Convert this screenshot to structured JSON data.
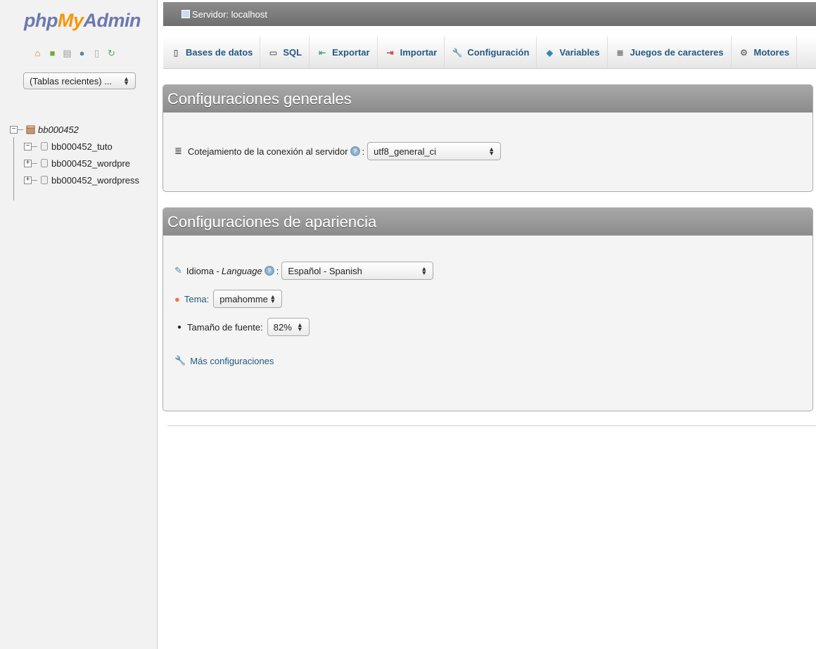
{
  "logo": {
    "php": "php",
    "my": "My",
    "admin": "Admin"
  },
  "sidebar": {
    "recent_tables": "(Tablas recientes) ...",
    "database": "bb000452",
    "tables": [
      "bb000452_tuto",
      "bb000452_wordpre",
      "bb000452_wordpress"
    ],
    "expanders": [
      "−",
      "+",
      "+"
    ]
  },
  "server_bar": {
    "label": "Servidor: localhost"
  },
  "tabs": [
    {
      "label": "Bases de datos",
      "icon": "database-icon"
    },
    {
      "label": "SQL",
      "icon": "sql-icon"
    },
    {
      "label": "Exportar",
      "icon": "export-icon"
    },
    {
      "label": "Importar",
      "icon": "import-icon"
    },
    {
      "label": "Configuración",
      "icon": "wrench-icon"
    },
    {
      "label": "Variables",
      "icon": "variables-icon"
    },
    {
      "label": "Juegos de caracteres",
      "icon": "charset-icon"
    },
    {
      "label": "Motores",
      "icon": "engines-icon"
    }
  ],
  "general": {
    "title": "Configuraciones generales",
    "collation_label": "Cotejamiento de la conexión al servidor",
    "collation_value": "utf8_general_ci"
  },
  "appearance": {
    "title": "Configuraciones de apariencia",
    "language_label": "Idioma - ",
    "language_label_en": "Language",
    "language_value": "Español - Spanish",
    "theme_label": "Tema:",
    "theme_value": "pmahomme",
    "font_label": "Tamaño de fuente:",
    "font_value": "82%",
    "more_settings": "Más configuraciones"
  }
}
